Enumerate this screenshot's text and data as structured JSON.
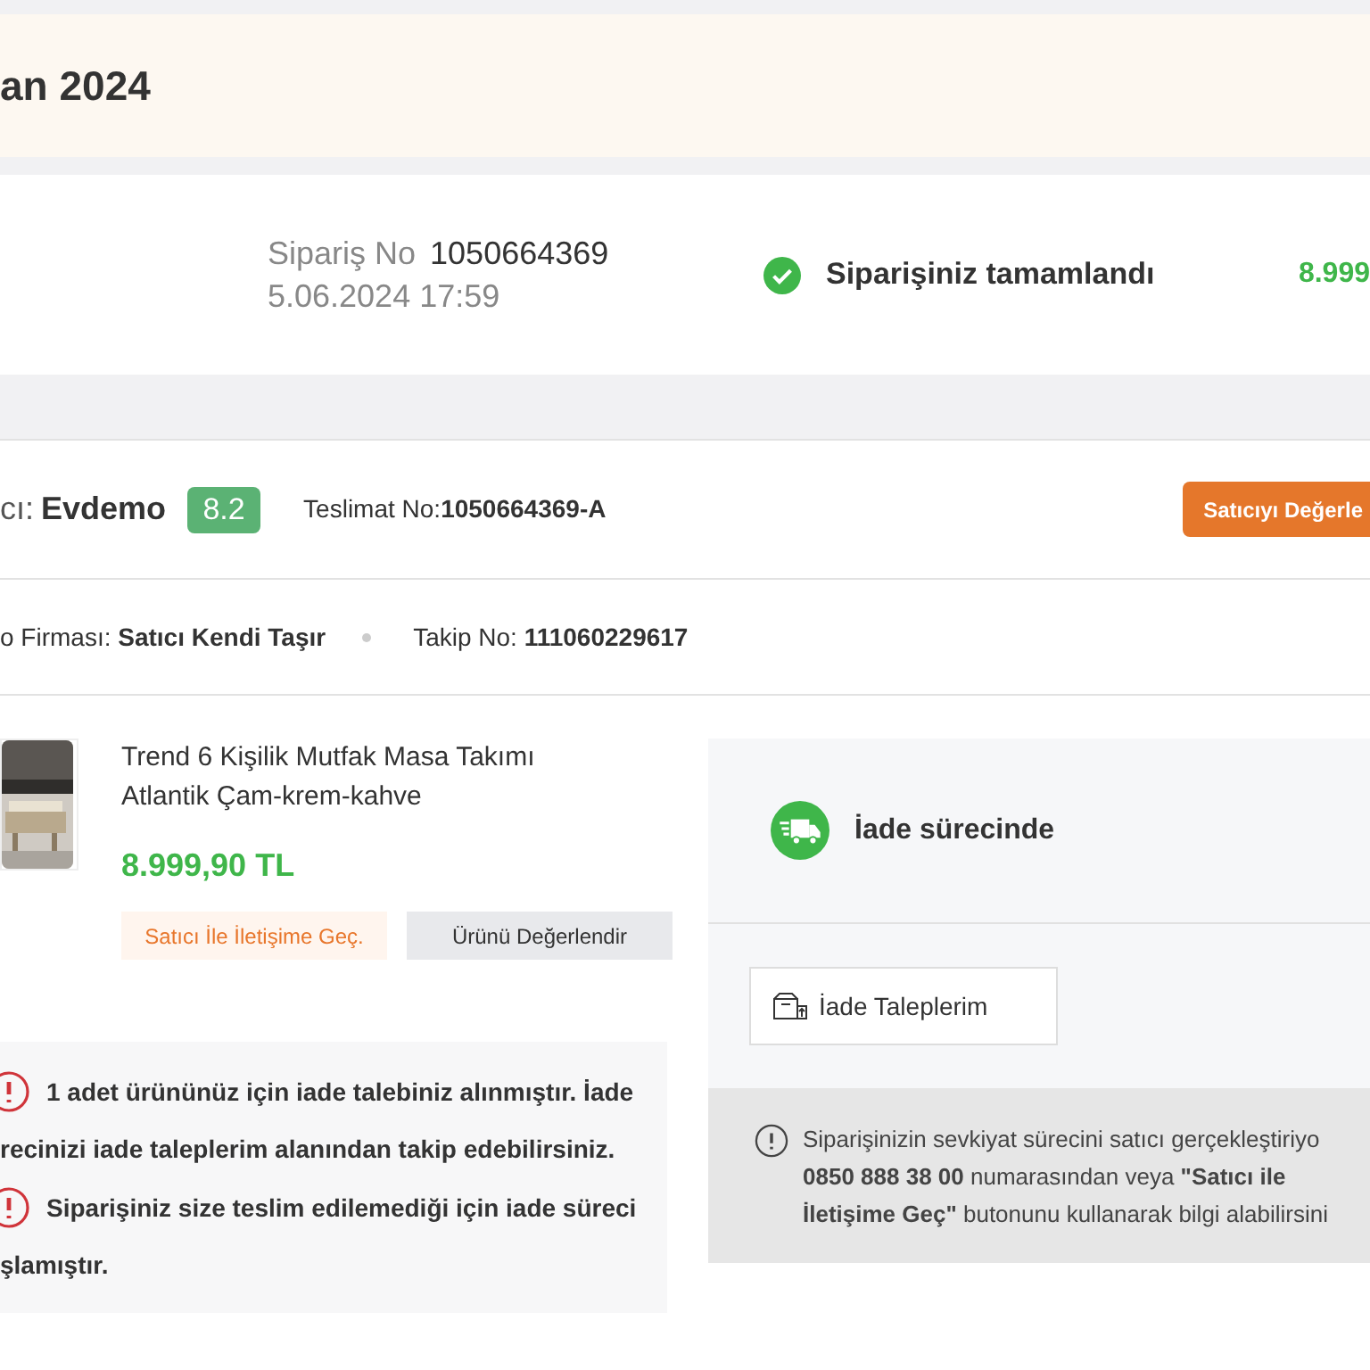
{
  "banner": {
    "title": "an 2024"
  },
  "summary": {
    "order_label": "Sipariş No",
    "order_no": "1050664369",
    "date": "5.06.2024 17:59",
    "status": "Siparişiniz tamamlandı",
    "total": "8.999"
  },
  "seller": {
    "label": "cı:",
    "name": "Evdemo",
    "score": "8.2",
    "delivery_label": "Teslimat No:",
    "delivery_no": "1050664369-A",
    "rate_button": "Satıcıyı Değerle"
  },
  "cargo": {
    "company_label": "o Firması:",
    "company": "Satıcı Kendi Taşır",
    "tracking_label": "Takip No:",
    "tracking_no": "111060229617"
  },
  "product": {
    "title_lines": [
      "Trend 6 Kişilik Mutfak Masa Takımı",
      "Atlantik Çam-krem-kahve"
    ],
    "price": "8.999,90 TL",
    "buttons": [
      {
        "label": "Satıcı İle İletişime Geç.",
        "kind": "contact"
      },
      {
        "label": "Ürünü Değerlendir",
        "kind": "review"
      }
    ]
  },
  "warnings": [
    {
      "lines": [
        "1 adet ürününüz için iade talebiniz alınmıştır. İade",
        "recinizi iade taleplerim alanından takip edebilirsiniz."
      ]
    },
    {
      "lines": [
        "Siparişiniz size teslim edilemediği için iade süreci",
        "şlamıştır."
      ]
    }
  ],
  "return_status": {
    "label": "İade sürecinde",
    "button": "İade Taleplerim",
    "info_lines": [
      "Siparişinizin sevkiyat sürecini satıcı gerçekleştiriyo",
      "**0850 888 38 00** numarasından veya **\"Satıcı ile**",
      "**İletişime Geç\"** butonunu kullanarak bilgi alabilirsini"
    ]
  }
}
